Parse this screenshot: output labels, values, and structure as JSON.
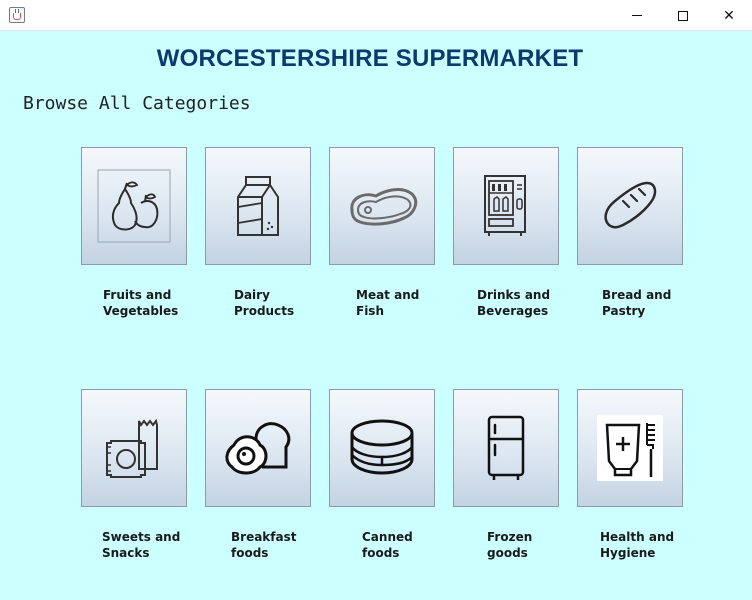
{
  "window": {
    "app_icon": "java-cup-icon",
    "controls": {
      "minimize_icon": "minimize-icon",
      "maximize_icon": "maximize-icon",
      "close_icon": "close-icon",
      "close_glyph": "✕"
    }
  },
  "header": {
    "store_name": "WORCESTERSHIRE SUPERMARKET",
    "browse_heading": "Browse All Categories"
  },
  "colors": {
    "background": "#ccffff",
    "title": "#0b3a6e"
  },
  "categories": [
    {
      "line1": "Fruits and",
      "line2": "Vegetables",
      "icon": "fruits-icon"
    },
    {
      "line1": "Dairy",
      "line2": "Products",
      "icon": "milk-carton-icon"
    },
    {
      "line1": "Meat and",
      "line2": "Fish",
      "icon": "steak-icon"
    },
    {
      "line1": "Drinks and",
      "line2": "Beverages",
      "icon": "vending-machine-icon"
    },
    {
      "line1": "Bread and",
      "line2": "Pastry",
      "icon": "bread-icon"
    },
    {
      "line1": "Sweets and",
      "line2": "Snacks",
      "icon": "snacks-icon"
    },
    {
      "line1": "Breakfast",
      "line2": "foods",
      "icon": "egg-toast-icon"
    },
    {
      "line1": "Canned",
      "line2": "foods",
      "icon": "can-icon"
    },
    {
      "line1": "Frozen",
      "line2": "goods",
      "icon": "fridge-icon"
    },
    {
      "line1": "Health and",
      "line2": "Hygiene",
      "icon": "toothpaste-icon"
    }
  ]
}
